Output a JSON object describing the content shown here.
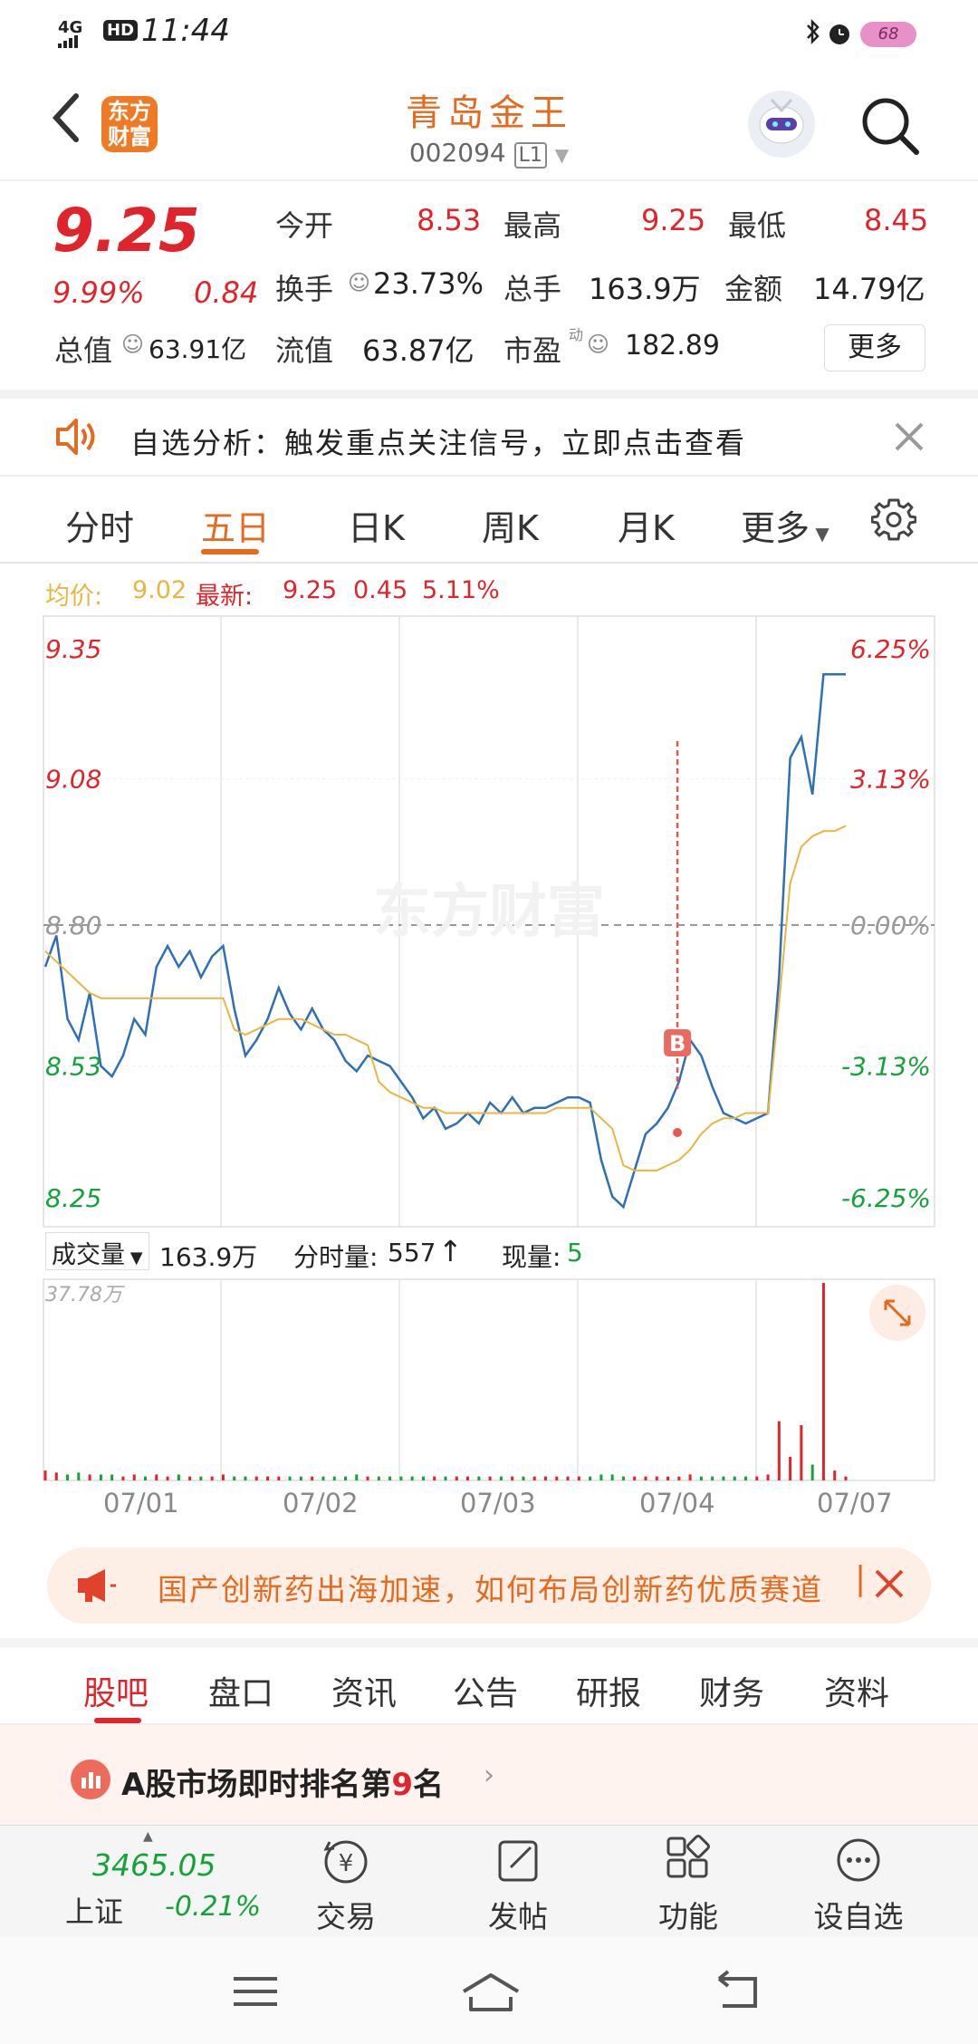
{
  "status_bar": {
    "network": "4G",
    "hd": "HD",
    "time": "11:44",
    "battery": "68"
  },
  "header": {
    "logo_line1": "东方",
    "logo_line2": "财富",
    "stock_name": "青岛金王",
    "stock_code": "002094",
    "level_badge": "L1"
  },
  "quote": {
    "price": "9.25",
    "change_pct": "9.99%",
    "change": "0.84",
    "open_label": "今开",
    "open": "8.53",
    "high_label": "最高",
    "high": "9.25",
    "low_label": "最低",
    "low": "8.45",
    "turnover_label": "换手",
    "turnover": "23.73%",
    "volume_label": "总手",
    "volume": "163.9万",
    "amount_label": "金额",
    "amount": "14.79亿",
    "mktcap_label": "总值",
    "mktcap": "63.91亿",
    "float_label": "流值",
    "float": "63.87亿",
    "pe_label": "市盈",
    "pe_sup": "动",
    "pe": "182.89",
    "more_label": "更多"
  },
  "notice": {
    "text": "自选分析：触发重点关注信号，立即点击查看"
  },
  "chart_tabs": {
    "items": [
      "分时",
      "五日",
      "日K",
      "周K",
      "月K",
      "更多"
    ],
    "active": "五日"
  },
  "chart_info": {
    "avg_label": "均价:",
    "avg": "9.02",
    "latest_label": "最新:",
    "latest": "9.25",
    "change": "0.45",
    "change_pct": "5.11%"
  },
  "chart_data": {
    "type": "line",
    "title": "",
    "y_left_ticks": [
      "9.35",
      "9.08",
      "8.80",
      "8.53",
      "8.25"
    ],
    "y_right_ticks": [
      "6.25%",
      "3.13%",
      "0.00%",
      "-3.13%",
      "-6.25%"
    ],
    "ylim": [
      8.25,
      9.35
    ],
    "prev_close": 8.8,
    "x_labels": [
      "07/01",
      "07/02",
      "07/03",
      "07/04",
      "07/07"
    ],
    "series": [
      {
        "values": [
          8.72,
          8.78,
          8.62,
          8.58,
          8.67,
          8.53,
          8.51,
          8.55,
          8.62,
          8.59,
          8.72,
          8.76,
          8.72,
          8.75,
          8.7,
          8.74,
          8.76,
          8.64,
          8.55,
          8.58,
          8.62,
          8.68,
          8.63,
          8.6,
          8.64,
          8.6,
          8.58,
          8.54,
          8.52,
          8.55,
          8.54,
          8.53,
          8.5,
          8.47,
          8.43,
          8.45,
          8.41,
          8.42,
          8.44,
          8.42,
          8.46,
          8.44,
          8.47,
          8.44,
          8.45,
          8.45,
          8.46,
          8.47,
          8.47,
          8.46,
          8.35,
          8.28,
          8.26,
          8.33,
          8.4,
          8.42,
          8.45,
          8.5,
          8.58,
          8.55,
          8.49,
          8.44,
          8.43,
          8.42,
          8.43,
          8.44,
          8.7,
          9.12,
          9.16,
          9.05,
          9.28,
          9.28,
          9.28
        ]
      },
      {
        "values": [
          8.75,
          8.73,
          8.71,
          8.69,
          8.67,
          8.66,
          8.66,
          8.66,
          8.66,
          8.66,
          8.66,
          8.66,
          8.66,
          8.66,
          8.66,
          8.66,
          8.66,
          8.6,
          8.59,
          8.6,
          8.61,
          8.62,
          8.62,
          8.62,
          8.61,
          8.6,
          8.59,
          8.59,
          8.58,
          8.57,
          8.5,
          8.48,
          8.47,
          8.46,
          8.45,
          8.45,
          8.44,
          8.44,
          8.44,
          8.44,
          8.44,
          8.44,
          8.44,
          8.44,
          8.44,
          8.44,
          8.45,
          8.45,
          8.45,
          8.45,
          8.43,
          8.41,
          8.34,
          8.33,
          8.33,
          8.33,
          8.34,
          8.35,
          8.37,
          8.4,
          8.42,
          8.43,
          8.43,
          8.44,
          8.44,
          8.44,
          8.65,
          8.88,
          8.95,
          8.97,
          8.98,
          8.98,
          8.99
        ]
      }
    ],
    "signal_marker": "B",
    "volume_max_label": "37.78万",
    "volume": [
      0.05,
      0.04,
      0.03,
      0.04,
      0.03,
      0.03,
      0.03,
      0.02,
      0.03,
      0.02,
      0.03,
      0.02,
      0.03,
      0.02,
      0.02,
      0.02,
      0.03,
      0.02,
      0.02,
      0.02,
      0.02,
      0.02,
      0.02,
      0.02,
      0.02,
      0.02,
      0.02,
      0.02,
      0.03,
      0.02,
      0.02,
      0.02,
      0.02,
      0.02,
      0.02,
      0.02,
      0.02,
      0.02,
      0.02,
      0.02,
      0.02,
      0.02,
      0.02,
      0.02,
      0.02,
      0.02,
      0.02,
      0.02,
      0.02,
      0.02,
      0.03,
      0.03,
      0.02,
      0.02,
      0.02,
      0.02,
      0.02,
      0.02,
      0.03,
      0.02,
      0.02,
      0.02,
      0.02,
      0.02,
      0.02,
      0.03,
      0.3,
      0.12,
      0.28,
      0.08,
      1.0,
      0.05,
      0.02
    ]
  },
  "volume_info": {
    "selector": "成交量",
    "total": "163.9万",
    "tick_label": "分时量:",
    "tick": "557",
    "now_label": "现量:",
    "now": "5"
  },
  "news_banner": {
    "text": "国产创新药出海加速，如何布局创新药优质赛道"
  },
  "bottom_tabs": {
    "items": [
      "股吧",
      "盘口",
      "资讯",
      "公告",
      "研报",
      "财务",
      "资料"
    ],
    "active": "股吧"
  },
  "rank": {
    "prefix": "A股市场即时排名第",
    "number": "9",
    "suffix": "名"
  },
  "index": {
    "value": "3465.05",
    "name": "上证",
    "change_pct": "-0.21%"
  },
  "toolbar": {
    "trade": "交易",
    "post": "发帖",
    "functions": "功能",
    "watchlist": "设自选"
  },
  "watermark": "东方财富",
  "colors": {
    "up": "#e0242b",
    "down": "#14a33b",
    "accent": "#e36a1e",
    "price_line": "#2e6fb5",
    "avg_line": "#e8b640"
  }
}
